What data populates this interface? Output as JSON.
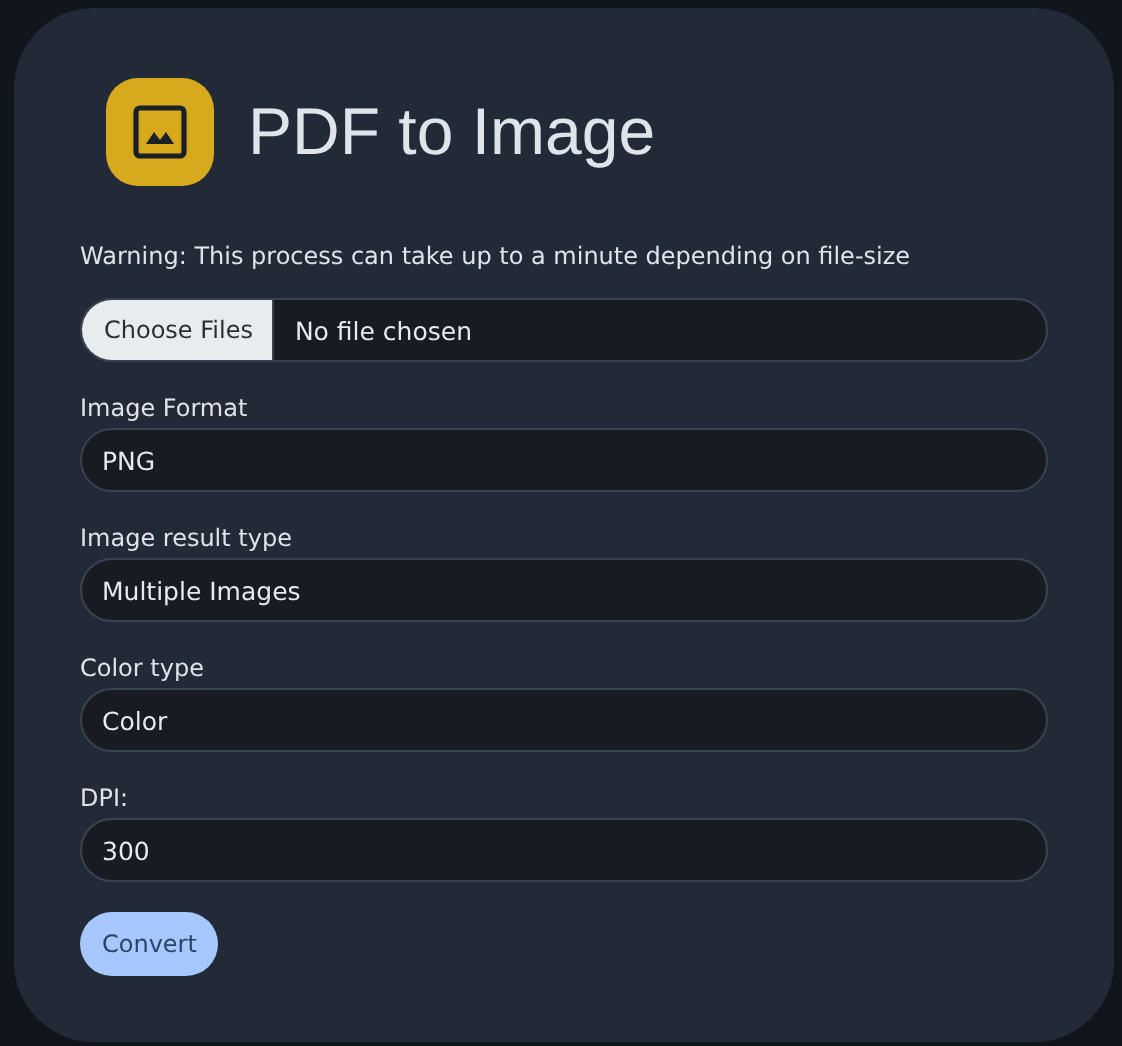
{
  "title": "PDF to Image",
  "warning": "Warning: This process can take up to a minute depending on file-size",
  "file_input": {
    "button": "Choose Files",
    "status": "No file chosen"
  },
  "fields": [
    {
      "label": "Image Format",
      "value": "PNG"
    },
    {
      "label": "Image result type",
      "value": "Multiple Images"
    },
    {
      "label": "Color type",
      "value": "Color"
    },
    {
      "label": "DPI:",
      "value": "300"
    }
  ],
  "submit": "Convert"
}
